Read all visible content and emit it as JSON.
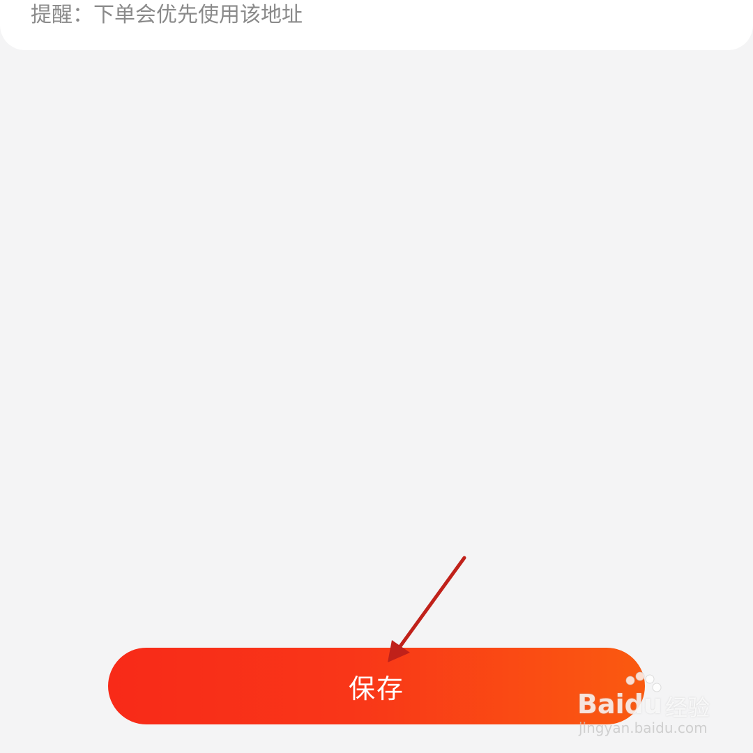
{
  "tip": {
    "text": "提醒：下单会优先使用该地址"
  },
  "save_button": {
    "label": "保存"
  },
  "annotation": {
    "arrow_color": "#c0211a"
  },
  "watermark": {
    "logo": "Baidu",
    "product": "经验",
    "url": "jingyan.baidu.com"
  },
  "colors": {
    "background": "#f4f4f5",
    "button_start": "#f82a18",
    "button_end": "#fa5a10"
  }
}
